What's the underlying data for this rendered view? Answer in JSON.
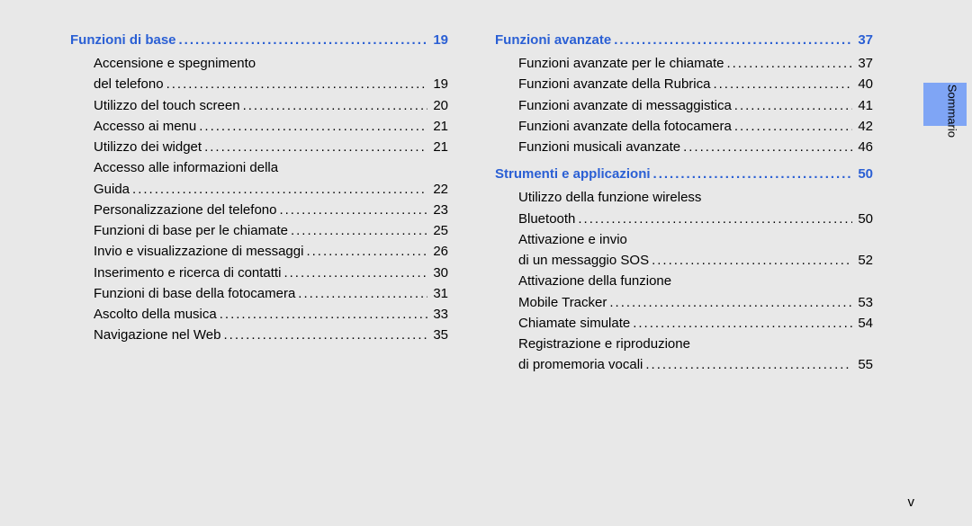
{
  "sections": [
    {
      "title": "Funzioni di base",
      "page": "19",
      "column": 0,
      "entries": [
        {
          "lines": [
            "Accensione e spegnimento",
            "del telefono"
          ],
          "page": "19"
        },
        {
          "lines": [
            "Utilizzo del touch screen"
          ],
          "page": "20"
        },
        {
          "lines": [
            "Accesso ai menu"
          ],
          "page": "21"
        },
        {
          "lines": [
            "Utilizzo dei widget"
          ],
          "page": "21"
        },
        {
          "lines": [
            "Accesso alle informazioni della",
            "Guida"
          ],
          "page": "22"
        },
        {
          "lines": [
            "Personalizzazione del telefono"
          ],
          "page": "23"
        },
        {
          "lines": [
            "Funzioni di base per le chiamate"
          ],
          "page": "25"
        },
        {
          "lines": [
            "Invio e visualizzazione di messaggi"
          ],
          "page": "26"
        },
        {
          "lines": [
            "Inserimento e ricerca di contatti"
          ],
          "page": "30"
        },
        {
          "lines": [
            "Funzioni di base della fotocamera"
          ],
          "page": "31"
        },
        {
          "lines": [
            "Ascolto della musica"
          ],
          "page": "33"
        },
        {
          "lines": [
            "Navigazione nel Web"
          ],
          "page": "35"
        }
      ]
    },
    {
      "title": "Funzioni avanzate",
      "page": "37",
      "column": 1,
      "entries": [
        {
          "lines": [
            "Funzioni avanzate per le chiamate"
          ],
          "page": "37"
        },
        {
          "lines": [
            "Funzioni avanzate della Rubrica"
          ],
          "page": "40"
        },
        {
          "lines": [
            "Funzioni avanzate di messaggistica"
          ],
          "page": "41"
        },
        {
          "lines": [
            "Funzioni avanzate della fotocamera"
          ],
          "page": "42"
        },
        {
          "lines": [
            "Funzioni musicali avanzate"
          ],
          "page": "46"
        }
      ]
    },
    {
      "title": "Strumenti e applicazioni",
      "page": "50",
      "column": 1,
      "entries": [
        {
          "lines": [
            "Utilizzo della funzione wireless",
            "Bluetooth"
          ],
          "page": "50"
        },
        {
          "lines": [
            "Attivazione e invio",
            "di un messaggio SOS"
          ],
          "page": "52"
        },
        {
          "lines": [
            "Attivazione della funzione",
            "Mobile Tracker"
          ],
          "page": "53"
        },
        {
          "lines": [
            "Chiamate simulate"
          ],
          "page": "54"
        },
        {
          "lines": [
            "Registrazione e riproduzione",
            "di promemoria vocali"
          ],
          "page": "55"
        }
      ]
    }
  ],
  "tab_label": "Sommario",
  "page_number": "v",
  "dots": "................................................................"
}
